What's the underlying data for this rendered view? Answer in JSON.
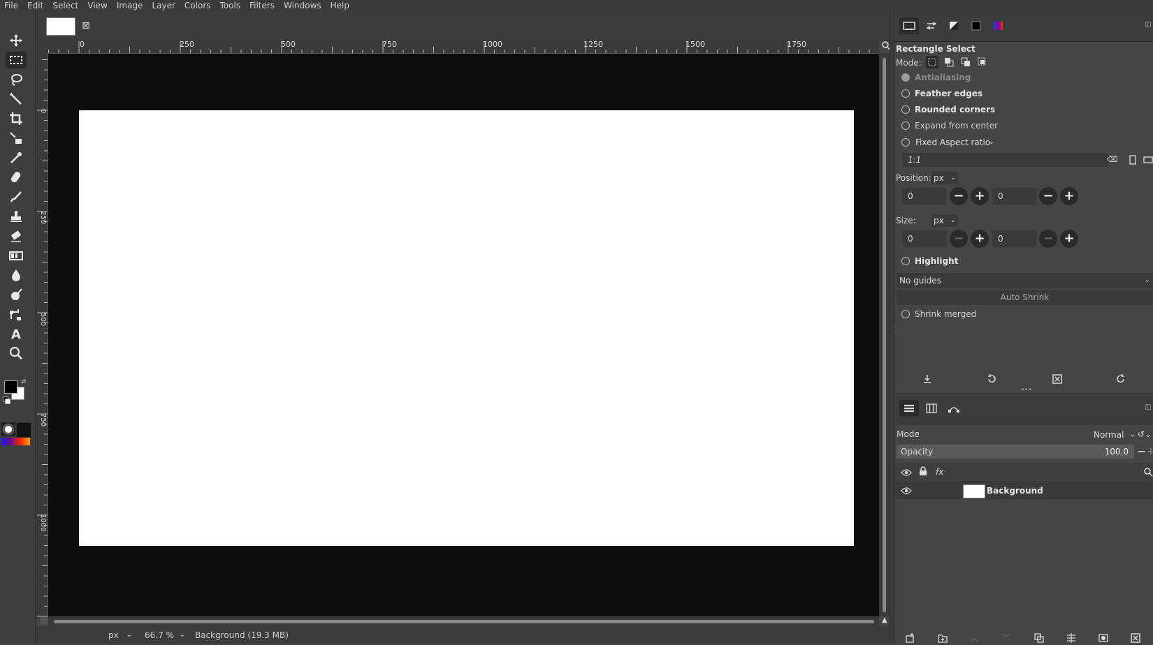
{
  "menu": [
    "File",
    "Edit",
    "Select",
    "View",
    "Image",
    "Layer",
    "Colors",
    "Tools",
    "Filters",
    "Windows",
    "Help"
  ],
  "ruler": {
    "h_labels": [
      "0",
      "250",
      "500",
      "750",
      "1000",
      "1250",
      "1500",
      "1750"
    ],
    "v_labels": [
      "0",
      "250",
      "500",
      "750",
      "1000"
    ]
  },
  "statusbar": {
    "unit": "px",
    "zoom": "66.7 %",
    "info": "Background (19.3 MB)"
  },
  "tool_options": {
    "title": "Rectangle Select",
    "mode_label": "Mode:",
    "antialiasing": "Antialiasing",
    "feather_edges": "Feather edges",
    "rounded_corners": "Rounded corners",
    "expand_from_center": "Expand from center",
    "fixed_label": "Fixed Aspect ratio",
    "ratio_value": "1:1",
    "position_label": "Position:",
    "position_unit": "px",
    "position_x": "0",
    "position_y": "0",
    "size_label": "Size:",
    "size_unit": "px",
    "size_w": "0",
    "size_h": "0",
    "highlight": "Highlight",
    "guides": "No guides",
    "auto_shrink": "Auto Shrink",
    "shrink_merged": "Shrink merged"
  },
  "layers": {
    "mode_label": "Mode",
    "mode_value": "Normal",
    "opacity_label": "Opacity",
    "opacity_value": "100.0",
    "items": [
      {
        "name": "Background"
      }
    ]
  },
  "colors": {
    "foreground": "#000000",
    "background": "#ffffff",
    "canvas_bg": "#0c0c0c"
  }
}
